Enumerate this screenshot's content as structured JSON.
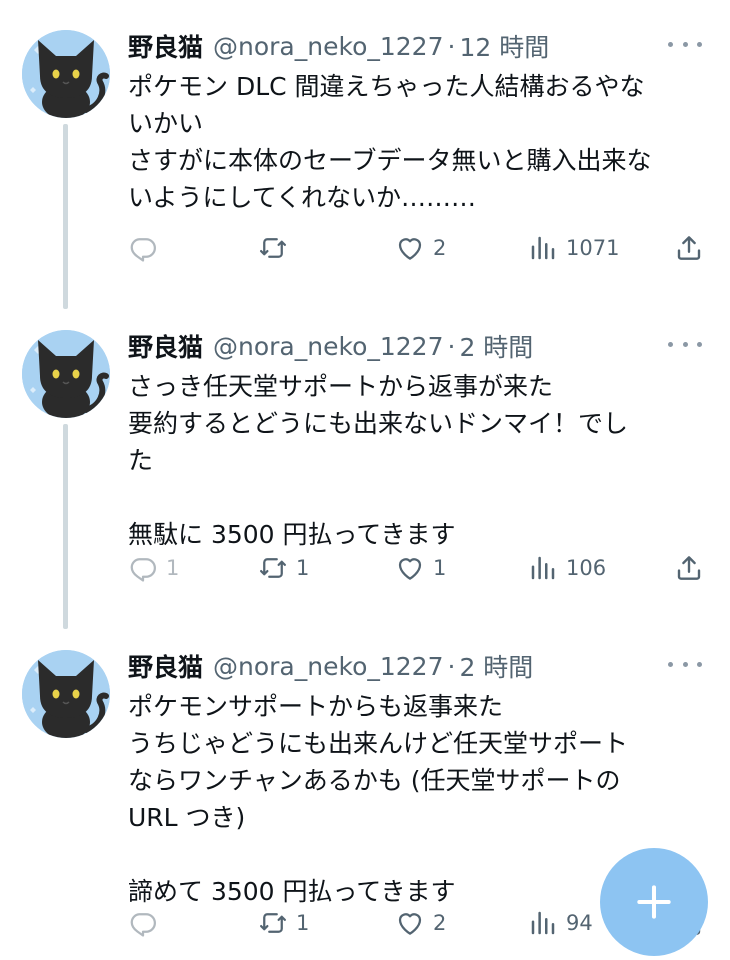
{
  "colors": {
    "text": "#0f1419",
    "muted": "#536471",
    "thread_line": "#cfd9de",
    "avatar_bg": "#a9d2f2",
    "fab": "#8dc4f2"
  },
  "tweets": [
    {
      "name": "野良猫",
      "handle": "@nora_neko_1227",
      "separator": "·",
      "time": "12 時間",
      "lines": [
        "ポケモン DLC 間違えちゃった人結構おるやな",
        "いかい",
        "さすがに本体のセーブデータ無いと購入出来な",
        "いようにしてくれないか………"
      ],
      "replies": "",
      "retweets": "",
      "likes": "2",
      "views": "1071"
    },
    {
      "name": "野良猫",
      "handle": "@nora_neko_1227",
      "separator": "·",
      "time": "2 時間",
      "lines": [
        "さっき任天堂サポートから返事が来た",
        "要約するとどうにも出来ないドンマイ！でし",
        "た",
        "",
        "無駄に 3500 円払ってきます"
      ],
      "replies": "1",
      "retweets": "1",
      "likes": "1",
      "views": "106"
    },
    {
      "name": "野良猫",
      "handle": "@nora_neko_1227",
      "separator": "·",
      "time": "2 時間",
      "lines": [
        "ポケモンサポートからも返事来た",
        "うちじゃどうにも出来んけど任天堂サポート",
        "ならワンチャンあるかも (任天堂サポートの",
        "URL つき)",
        "",
        "諦めて 3500 円払ってきます"
      ],
      "replies": "",
      "retweets": "1",
      "likes": "2",
      "views": "94"
    }
  ],
  "icons": {
    "more": "more-icon",
    "reply": "reply-icon",
    "retweet": "retweet-icon",
    "like": "heart-icon",
    "views": "views-icon",
    "share": "share-icon",
    "compose": "plus-icon",
    "avatar": "black-cat-avatar"
  }
}
